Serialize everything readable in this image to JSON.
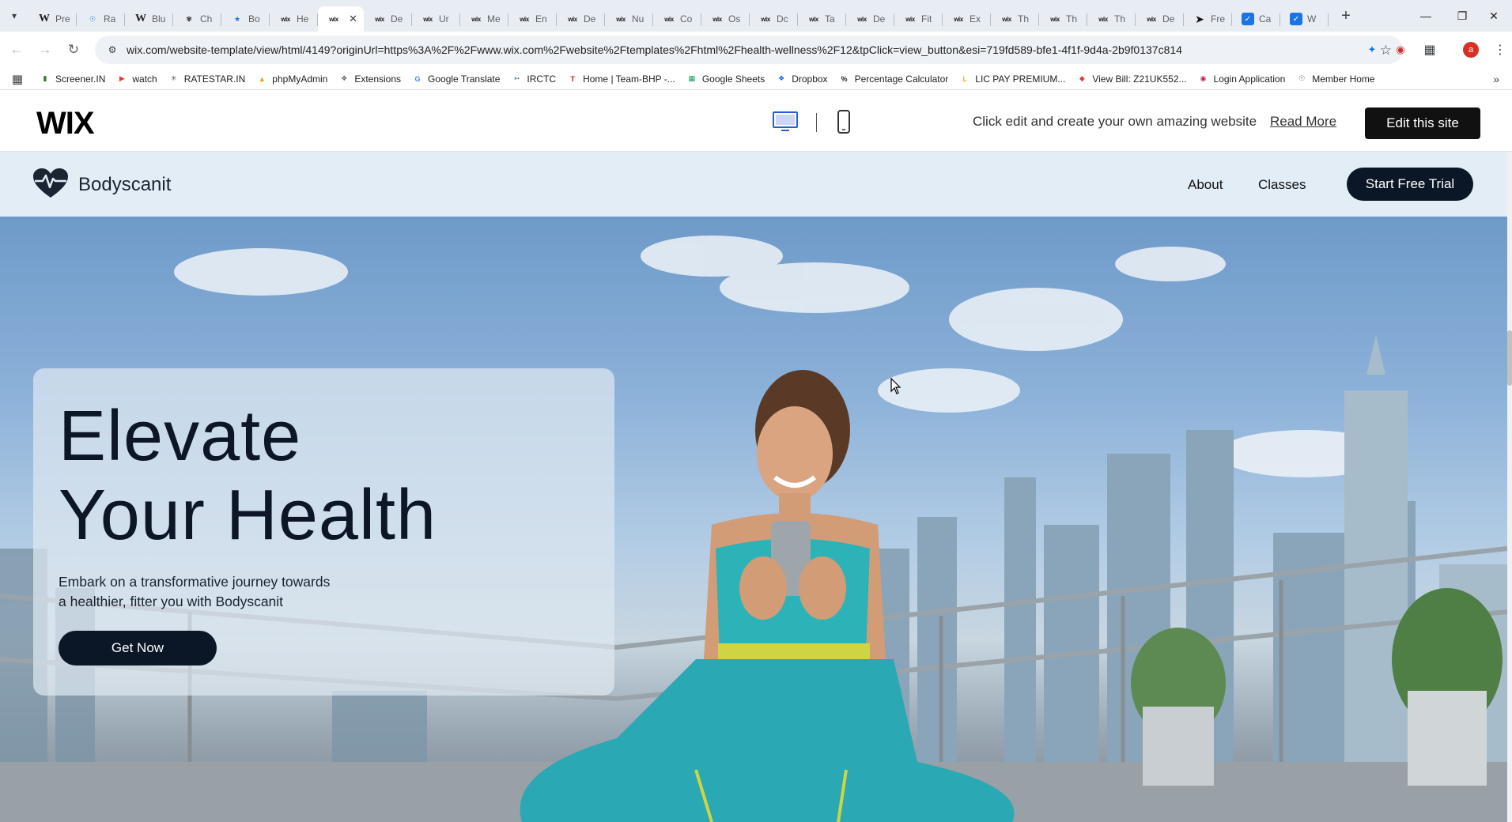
{
  "browser": {
    "tabs": [
      {
        "icon": "wikipedia",
        "title": "Pre"
      },
      {
        "icon": "globe",
        "title": "Ra"
      },
      {
        "icon": "wikipedia",
        "title": "Blu"
      },
      {
        "icon": "chatgpt",
        "title": "Ch"
      },
      {
        "icon": "star",
        "title": "Bo"
      },
      {
        "icon": "wix",
        "title": "He"
      },
      {
        "icon": "wix",
        "title": "",
        "active": true
      },
      {
        "icon": "wix",
        "title": "De"
      },
      {
        "icon": "wix",
        "title": "Ur"
      },
      {
        "icon": "wix",
        "title": "Me"
      },
      {
        "icon": "wix",
        "title": "En"
      },
      {
        "icon": "wix",
        "title": "De"
      },
      {
        "icon": "wix",
        "title": "Nu"
      },
      {
        "icon": "wix",
        "title": "Co"
      },
      {
        "icon": "wix",
        "title": "Os"
      },
      {
        "icon": "wix",
        "title": "Dc"
      },
      {
        "icon": "wix",
        "title": "Ta"
      },
      {
        "icon": "wix",
        "title": "De"
      },
      {
        "icon": "wix",
        "title": "Fit"
      },
      {
        "icon": "wix",
        "title": "Ex"
      },
      {
        "icon": "wix",
        "title": "Th"
      },
      {
        "icon": "wix",
        "title": "Th"
      },
      {
        "icon": "wix",
        "title": "Th"
      },
      {
        "icon": "wix",
        "title": "De"
      },
      {
        "icon": "framer",
        "title": "Fre"
      },
      {
        "icon": "blue-square",
        "title": "Ca"
      },
      {
        "icon": "blue-square",
        "title": "W"
      }
    ],
    "url": "wix.com/website-template/view/html/4149?originUrl=https%3A%2F%2Fwww.wix.com%2Fwebsite%2Ftemplates%2Fhtml%2Fhealth-wellness%2F12&tpClick=view_button&esi=719fd589-bfe1-4f1f-9d4a-2b9f0137c814",
    "profile_initial": "a",
    "bookmarks": [
      {
        "label": "Screener.IN",
        "icon": "bar-chart",
        "color": "#2e7d32"
      },
      {
        "label": "watch",
        "icon": "youtube",
        "color": "#e53935"
      },
      {
        "label": "RATESTAR.IN",
        "icon": "star",
        "color": "#555555"
      },
      {
        "label": "phpMyAdmin",
        "icon": "php",
        "color": "#f39c12"
      },
      {
        "label": "Extensions",
        "icon": "puzzle",
        "color": "#5f6368"
      },
      {
        "label": "Google Translate",
        "icon": "translate",
        "color": "#4285f4"
      },
      {
        "label": "IRCTC",
        "icon": "train",
        "color": "#1a4d8f"
      },
      {
        "label": "Home | Team-BHP -...",
        "icon": "team-bhp",
        "color": "#b71c1c"
      },
      {
        "label": "Google Sheets",
        "icon": "sheets",
        "color": "#0f9d58"
      },
      {
        "label": "Dropbox",
        "icon": "dropbox",
        "color": "#0061fe"
      },
      {
        "label": "Percentage Calculator",
        "icon": "percent",
        "color": "#222222"
      },
      {
        "label": "LIC PAY PREMIUM...",
        "icon": "lic",
        "color": "#f9a825"
      },
      {
        "label": "View Bill: Z21UK552...",
        "icon": "bill",
        "color": "#e53935"
      },
      {
        "label": "Login Application",
        "icon": "login",
        "color": "#c2185b"
      },
      {
        "label": "Member Home",
        "icon": "globe",
        "color": "#5f6368"
      }
    ]
  },
  "wix_bar": {
    "logo": "WIX",
    "promo": "Click edit and create your own amazing website",
    "read_more": "Read More",
    "edit_button": "Edit this site"
  },
  "site": {
    "name": "Bodyscanit",
    "nav": {
      "about": "About",
      "classes": "Classes"
    },
    "cta": "Start Free Trial",
    "hero": {
      "title_line1": "Elevate",
      "title_line2": "Your Health",
      "subtitle_line1": "Embark on a transformative journey towards",
      "subtitle_line2": "a healthier, fitter you with Bodyscanit",
      "button": "Get Now"
    }
  },
  "colors": {
    "header_bg": "#e3edf6",
    "dark_button": "#0b1626",
    "wix_edit_button": "#111111"
  }
}
